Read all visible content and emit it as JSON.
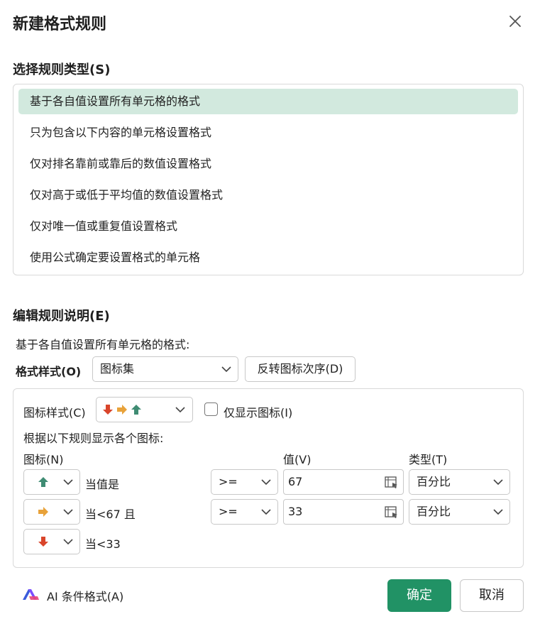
{
  "dialog": {
    "title": "新建格式规则"
  },
  "rule_type": {
    "heading": "选择规则类型(S)",
    "items": [
      "基于各自值设置所有单元格的格式",
      "只为包含以下内容的单元格设置格式",
      "仅对排名靠前或靠后的数值设置格式",
      "仅对高于或低于平均值的数值设置格式",
      "仅对唯一值或重复值设置格式",
      "使用公式确定要设置格式的单元格"
    ],
    "selected_index": 0
  },
  "edit": {
    "heading": "编辑规则说明(E)",
    "subtitle": "基于各自值设置所有单元格的格式:",
    "format_style_label": "格式样式(O)",
    "format_style_value": "图标集",
    "reverse_button": "反转图标次序(D)",
    "icon_style_label": "图标样式(C)",
    "show_icon_only_label": "仅显示图标(I)",
    "show_icon_only_checked": false,
    "rules_caption": "根据以下规则显示各个图标:",
    "col_icon": "图标(N)",
    "col_value": "值(V)",
    "col_type": "类型(T)",
    "rows": [
      {
        "icon": "up-arrow-icon",
        "condition": "当值是",
        "operator": ">=",
        "value": "67",
        "type": "百分比"
      },
      {
        "icon": "right-arrow-icon",
        "condition": "当<67 且",
        "operator": ">=",
        "value": "33",
        "type": "百分比"
      },
      {
        "icon": "down-arrow-icon",
        "condition": "当<33"
      }
    ]
  },
  "footer": {
    "ai_label": "AI 条件格式(A)",
    "ok": "确定",
    "cancel": "取消"
  },
  "colors": {
    "accent": "#219265",
    "selected_row": "#d2e9de",
    "arrow_up": "#3f8c73",
    "arrow_right": "#e8a23a",
    "arrow_down": "#d9452b"
  }
}
